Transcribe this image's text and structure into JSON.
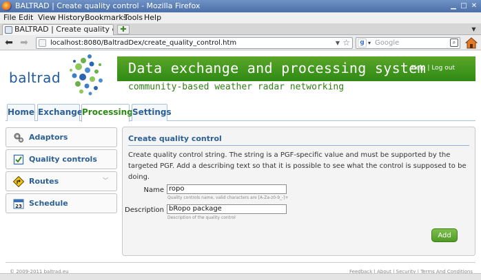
{
  "window": {
    "title": "BALTRAD | Create quality control - Mozilla Firefox"
  },
  "menu": [
    "File",
    "Edit",
    "View",
    "History",
    "Bookmarks",
    "Tools",
    "Help"
  ],
  "browser": {
    "tab_title": "BALTRAD | Create quality control",
    "url": "localhost:8080/BaltradDex/create_quality_control.htm",
    "search_placeholder": "Google"
  },
  "site": {
    "logo_text": "baltrad",
    "banner_title": "Data exchange and processing system",
    "links": {
      "help": "Help",
      "separator": "|",
      "logout": "Log out"
    },
    "tagline": "community-based weather radar networking"
  },
  "main_tabs": [
    {
      "label": "Home",
      "active": false
    },
    {
      "label": "Exchange",
      "active": false
    },
    {
      "label": "Processing",
      "active": true
    },
    {
      "label": "Settings",
      "active": false
    }
  ],
  "sidebar": {
    "items": [
      {
        "label": "Adaptors",
        "icon": "gears-icon"
      },
      {
        "label": "Quality controls",
        "icon": "checkbox-icon"
      },
      {
        "label": "Routes",
        "icon": "route-sign-icon"
      },
      {
        "label": "Schedule",
        "icon": "calendar-icon",
        "calendar_day": "23"
      }
    ]
  },
  "panel": {
    "heading": "Create quality control",
    "description": "Create quality control string. The string is a PGF-specific value and must be supported by the targeted PGF. Add a describing text so that it is possible to see what the control is supposed to be doing.",
    "name_label": "Name",
    "name_value": "ropo",
    "name_hint": "Quality controls name, valid characters are [A-Za-z0-9_-]+",
    "description_label": "Description",
    "description_value": "bRopo package",
    "description_hint": "Description of the quality control",
    "add_button": "Add"
  },
  "footer": {
    "copyright": "© 2009-2011 baltrad.eu",
    "links": "Feedback | About | Security | Terms And Conditions"
  },
  "colors": {
    "banner_green": "#3d9a1c",
    "link_blue": "#2b5f95",
    "active_tab_green": "#2f8a14"
  }
}
